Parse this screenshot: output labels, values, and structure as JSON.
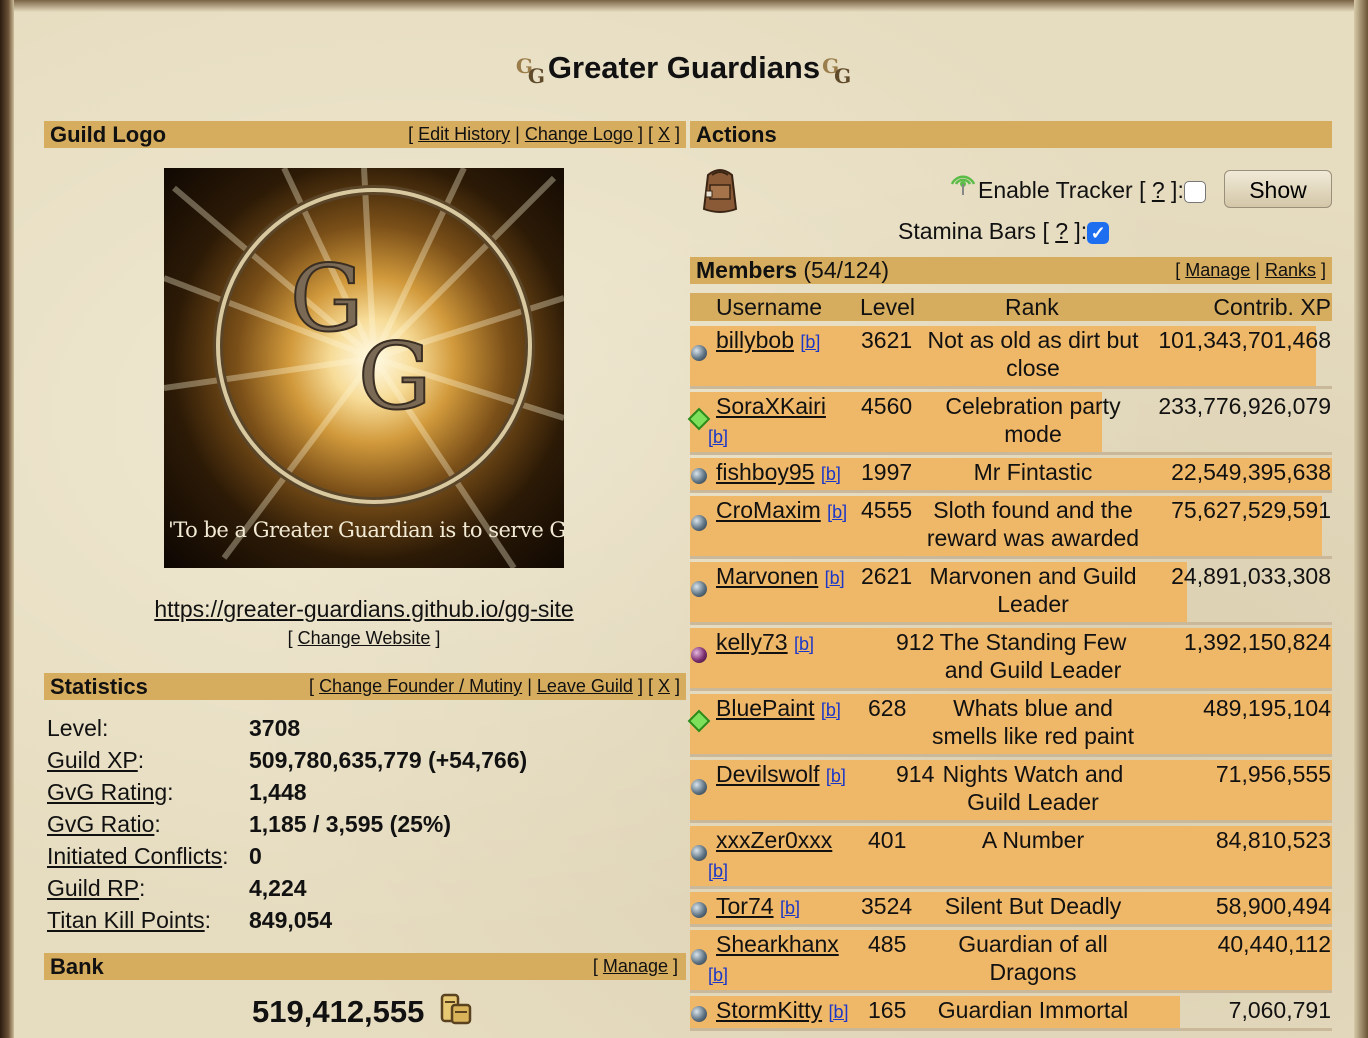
{
  "guild": {
    "name": "Greater Guardians",
    "badge_letters": [
      "G",
      "G"
    ]
  },
  "logo_panel": {
    "heading": "Guild Logo",
    "links": [
      "Edit History",
      "Change Logo",
      "X"
    ],
    "logo_letters": [
      "G",
      "G"
    ],
    "tagline": "'To be a Greater Guardian is to serve GG'",
    "website": "https://greater-guardians.github.io/gg-site",
    "change_website": "Change Website"
  },
  "statistics": {
    "heading": "Statistics",
    "links": [
      "Change Founder / Mutiny",
      "Leave Guild",
      "X"
    ],
    "rows": [
      {
        "label": "Level",
        "value": "3708",
        "extra": ""
      },
      {
        "label": "Guild XP",
        "value": "509,780,635,779",
        "extra": "(+54,766)"
      },
      {
        "label": "GvG Rating",
        "value": "1,448",
        "extra": ""
      },
      {
        "label": "GvG Ratio",
        "value": "1,185 / 3,595 (25%)",
        "extra": ""
      },
      {
        "label": "Initiated Conflicts",
        "value": "0",
        "extra": ""
      },
      {
        "label": "Guild RP",
        "value": "4,224",
        "extra": ""
      },
      {
        "label": "Titan Kill Points",
        "value": "849,054",
        "extra": ""
      }
    ]
  },
  "bank": {
    "heading": "Bank",
    "manage": "Manage",
    "amount": "519,412,555"
  },
  "actions": {
    "heading": "Actions",
    "enable_tracker": "Enable Tracker",
    "help": "?",
    "tracker_enabled": false,
    "show_button": "Show",
    "stamina_bars": "Stamina Bars",
    "stamina_enabled": true
  },
  "members": {
    "heading": "Members",
    "count": "(54/124)",
    "links": [
      "Manage",
      "Ranks"
    ],
    "columns": [
      "Username",
      "Level",
      "Rank",
      "Contrib. XP"
    ],
    "rows": [
      {
        "username": "billybob",
        "b": "[b]",
        "level": "3621",
        "rank": [
          "Not as old as dirt but",
          "close"
        ],
        "xp": "101,343,701,468",
        "status": "grey"
      },
      {
        "username": "SoraXKairi",
        "b": "[b]",
        "level": "4560",
        "rank": [
          "Celebration party",
          "mode"
        ],
        "xp": "233,776,926,079",
        "status": "green"
      },
      {
        "username": "fishboy95",
        "b": "[b]",
        "level": "1997",
        "rank": [
          "Mr Fintastic"
        ],
        "xp": "22,549,395,638",
        "status": "grey"
      },
      {
        "username": "CroMaxim",
        "b": "[b]",
        "level": "4555",
        "rank": [
          "Sloth found and the",
          "reward was awarded"
        ],
        "xp": "75,627,529,591",
        "status": "grey"
      },
      {
        "username": "Marvonen",
        "b": "[b]",
        "level": "2621",
        "rank": [
          "Marvonen and Guild",
          "Leader"
        ],
        "xp": "24,891,033,308",
        "status": "grey"
      },
      {
        "username": "kelly73",
        "b": "[b]",
        "level": "912",
        "rank": [
          "The Standing Few",
          "and Guild Leader"
        ],
        "xp": "1,392,150,824",
        "status": "purple"
      },
      {
        "username": "BluePaint",
        "b": "[b]",
        "level": "628",
        "rank": [
          "Whats blue and",
          "smells like red paint"
        ],
        "xp": "489,195,104",
        "status": "green"
      },
      {
        "username": "Devilswolf",
        "b": "[b]",
        "level": "914",
        "rank": [
          "Nights Watch and",
          "Guild Leader"
        ],
        "xp": "71,956,555",
        "status": "grey"
      },
      {
        "username": "xxxZer0xxx",
        "b": "[b]",
        "level": "401",
        "rank": [
          "A Number"
        ],
        "xp": "84,810,523",
        "status": "grey"
      },
      {
        "username": "Tor74",
        "b": "[b]",
        "level": "3524",
        "rank": [
          "Silent But Deadly"
        ],
        "xp": "58,900,494",
        "status": "grey"
      },
      {
        "username": "Shearkhanx",
        "b": "[b]",
        "level": "485",
        "rank": [
          "Guardian of all",
          "Dragons"
        ],
        "xp": "40,440,112",
        "status": "grey"
      },
      {
        "username": "StormKitty",
        "b": "[b]",
        "level": "165",
        "rank": [
          "Guardian Immortal"
        ],
        "xp": "7,060,791",
        "status": "grey"
      }
    ]
  }
}
